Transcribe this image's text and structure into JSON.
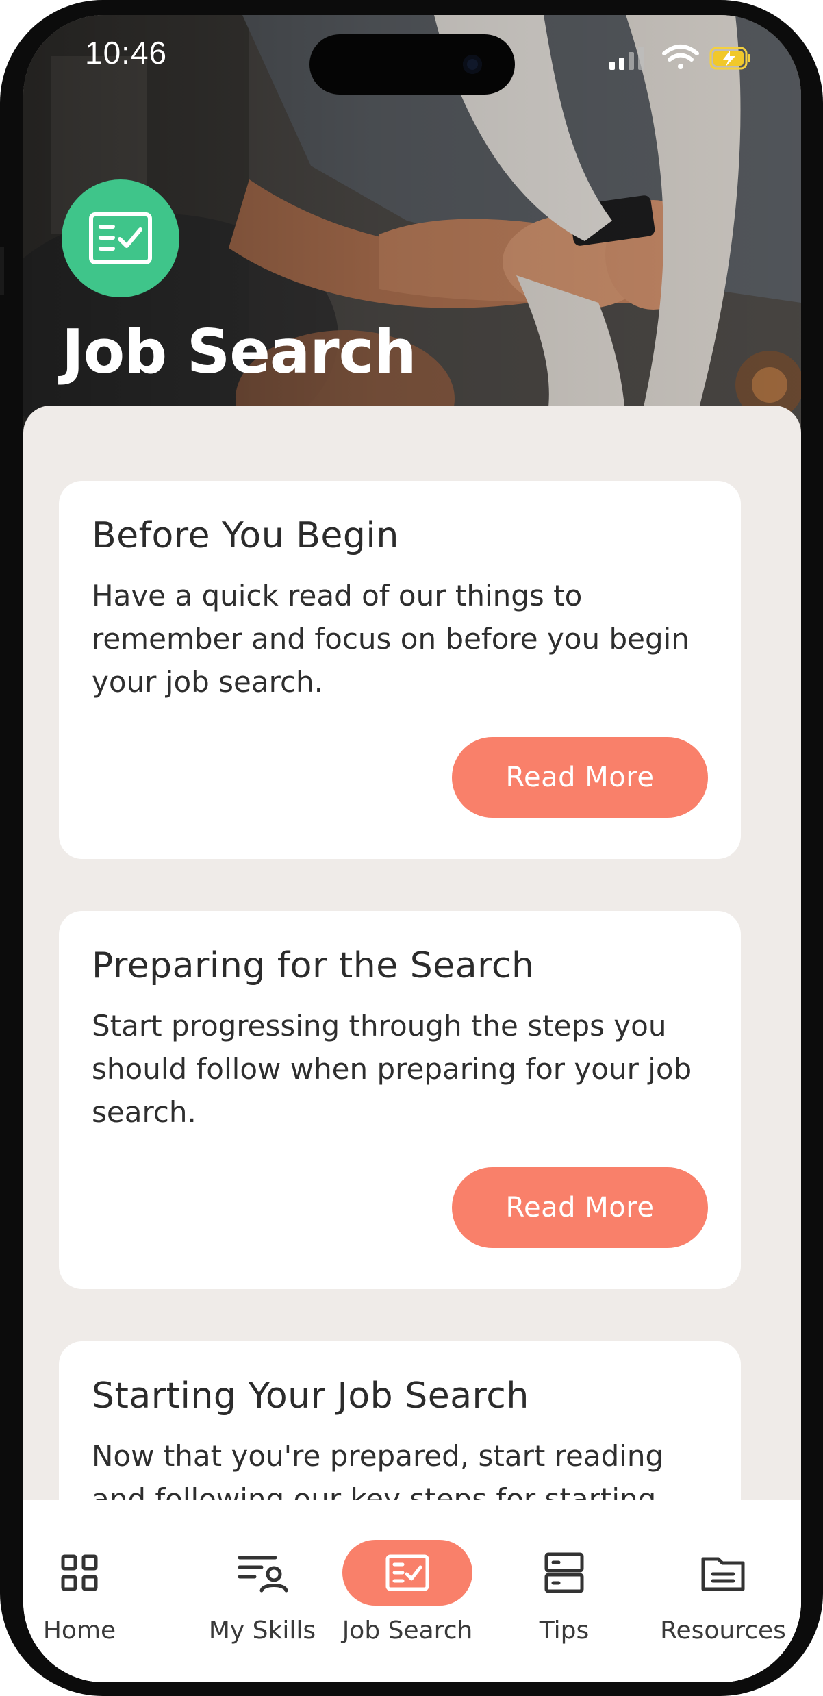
{
  "status_bar": {
    "time": "10:46",
    "icons": [
      "cellular-signal-icon",
      "wifi-icon",
      "battery-charging-icon"
    ]
  },
  "header": {
    "title": "Job Search",
    "icon": "checklist-icon",
    "badge_color": "#3fc58a"
  },
  "cards": [
    {
      "title": "Before You Begin",
      "body": "Have a quick read of our things to remember and focus on before you begin your job search.",
      "button": "Read More"
    },
    {
      "title": "Preparing for the Search",
      "body": "Start progressing through the steps you should follow when preparing for your job search.",
      "button": "Read More"
    },
    {
      "title": "Starting Your Job Search",
      "body": "Now that you're prepared, start reading and following our key steps for starting"
    }
  ],
  "bottom_nav": {
    "items": [
      {
        "label": "Home",
        "icon": "grid-icon",
        "active": false
      },
      {
        "label": "My Skills",
        "icon": "person-list-icon",
        "active": false
      },
      {
        "label": "Job Search",
        "icon": "checklist-icon",
        "active": true
      },
      {
        "label": "Tips",
        "icon": "stacked-boxes-icon",
        "active": false
      },
      {
        "label": "Resources",
        "icon": "folder-icon",
        "active": false
      }
    ]
  },
  "colors": {
    "accent": "#f9806a",
    "background": "#efebe8",
    "card": "#ffffff",
    "badge": "#3fc58a"
  }
}
